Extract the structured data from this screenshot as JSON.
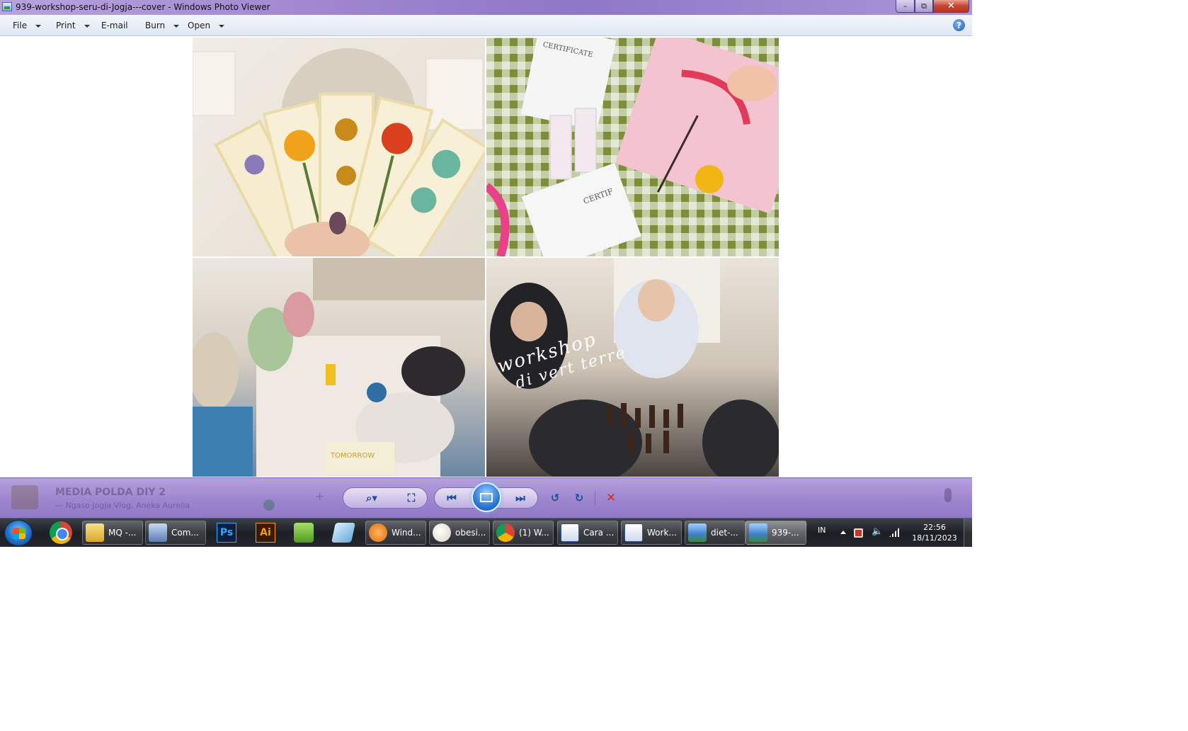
{
  "window": {
    "title": "939-workshop-seru-di-Jogja---cover - Windows Photo Viewer",
    "minimize_glyph": "–",
    "maximize_glyph": "⧉",
    "close_glyph": "✕"
  },
  "menubar": {
    "items": [
      {
        "label": "File",
        "has_dropdown": true
      },
      {
        "label": "Print",
        "has_dropdown": true
      },
      {
        "label": "E-mail",
        "has_dropdown": false
      },
      {
        "label": "Burn",
        "has_dropdown": true
      },
      {
        "label": "Open",
        "has_dropdown": true
      }
    ],
    "help_glyph": "?"
  },
  "photo": {
    "overlay_text_line1": "workshop",
    "overlay_text_line2": "di vert terre"
  },
  "controls": {
    "ghost_media_title": "MEDIA POLDA DIY 2",
    "ghost_media_subtitle": "— Ngaso Jogja Vlog, Aneka Aurelia",
    "ghost_plus": "+",
    "zoom_glyph": "⌕▾",
    "fit_glyph": "⛶",
    "prev_glyph": "⏮",
    "next_glyph": "⏭",
    "rotate_left_glyph": "↺",
    "rotate_right_glyph": "↻",
    "delete_glyph": "✕"
  },
  "taskbar": {
    "pinned": [
      {
        "name": "chrome-icon",
        "label": ""
      },
      {
        "name": "photoshop-icon",
        "label": "Ps"
      },
      {
        "name": "illustrator-icon",
        "label": "Ai"
      },
      {
        "name": "green-app-icon",
        "label": ""
      },
      {
        "name": "blue-app-icon",
        "label": ""
      }
    ],
    "tasks": [
      {
        "label": "MQ -...",
        "icon": "folder-icon"
      },
      {
        "label": "Com...",
        "icon": "computer-icon"
      },
      {
        "label": "Wind...",
        "icon": "media-player-icon"
      },
      {
        "label": "obesi...",
        "icon": "paint-icon"
      },
      {
        "label": "(1) W...",
        "icon": "chrome-icon"
      },
      {
        "label": "Cara ...",
        "icon": "word-icon"
      },
      {
        "label": "Work...",
        "icon": "word-icon"
      },
      {
        "label": "diet-...",
        "icon": "photo-viewer-icon"
      },
      {
        "label": "939-...",
        "icon": "photo-viewer-icon"
      }
    ],
    "tray": {
      "language": "IN",
      "volume_glyph": "🔈",
      "time": "22:56",
      "date": "18/11/2023"
    }
  }
}
